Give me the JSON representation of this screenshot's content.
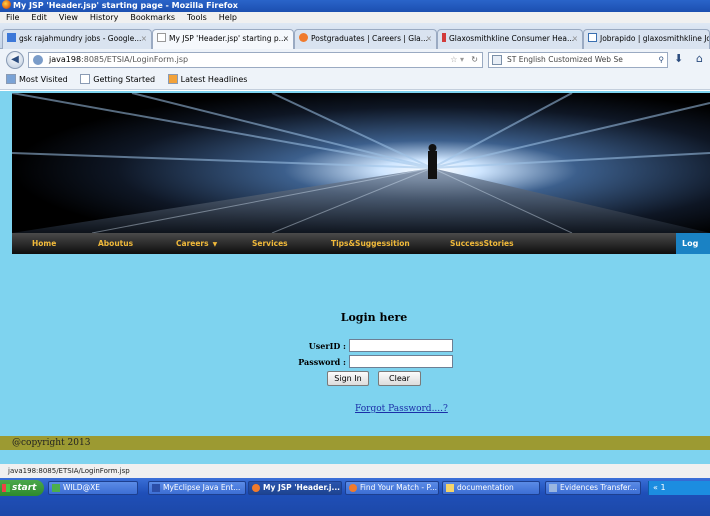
{
  "window": {
    "title": "My JSP 'Header.jsp' starting page - Mozilla Firefox"
  },
  "menu": {
    "items": [
      "File",
      "Edit",
      "View",
      "History",
      "Bookmarks",
      "Tools",
      "Help"
    ]
  },
  "tabs": [
    {
      "label": "gsk rajahmundry jobs - Google...",
      "icon": "google-icon",
      "active": false
    },
    {
      "label": "My JSP 'Header.jsp' starting p...",
      "icon": "page-icon",
      "active": true
    },
    {
      "label": "Postgraduates | Careers | Gla...",
      "icon": "gsk-icon",
      "active": false
    },
    {
      "label": "Glaxosmithkline Consumer Hea...",
      "icon": "t-icon",
      "active": false
    },
    {
      "label": "Jobrapido | glaxosmithkline Jo...",
      "icon": "jr-icon",
      "active": false
    }
  ],
  "nav": {
    "url_host": "java198",
    "url_rest": ":8085/ETSIA/LoginForm.jsp",
    "search_text": "ST English Customized Web Se"
  },
  "bookmarks": {
    "items": [
      "Most Visited",
      "Getting Started",
      "Latest Headlines"
    ]
  },
  "site_nav": {
    "links": [
      "Home",
      "Aboutus",
      "Careers",
      "Services",
      "Tips&Suggessition",
      "SuccessStories"
    ],
    "login_tab": "Log"
  },
  "login": {
    "heading": "Login here",
    "userid_label": "UserID :",
    "password_label": "Password :",
    "userid_value": "",
    "password_value": "",
    "signin_button": "Sign In",
    "clear_button": "Clear",
    "forgot_link": "Forgot Password....?"
  },
  "footer": {
    "text": "@copyright 2013"
  },
  "status": {
    "text": "java198:8085/ETSIA/LoginForm.jsp"
  },
  "taskbar": {
    "start": "start",
    "tasks": [
      {
        "label": "WILD@XE",
        "active": false
      },
      {
        "label": "MyEclipse Java Ent...",
        "active": false
      },
      {
        "label": "My JSP 'Header.j...",
        "active": true
      },
      {
        "label": "Find Your Match - P...",
        "active": false
      },
      {
        "label": "documentation",
        "active": false
      },
      {
        "label": "Evidences Transfer...",
        "active": false
      }
    ],
    "tray_text": "« 1"
  }
}
